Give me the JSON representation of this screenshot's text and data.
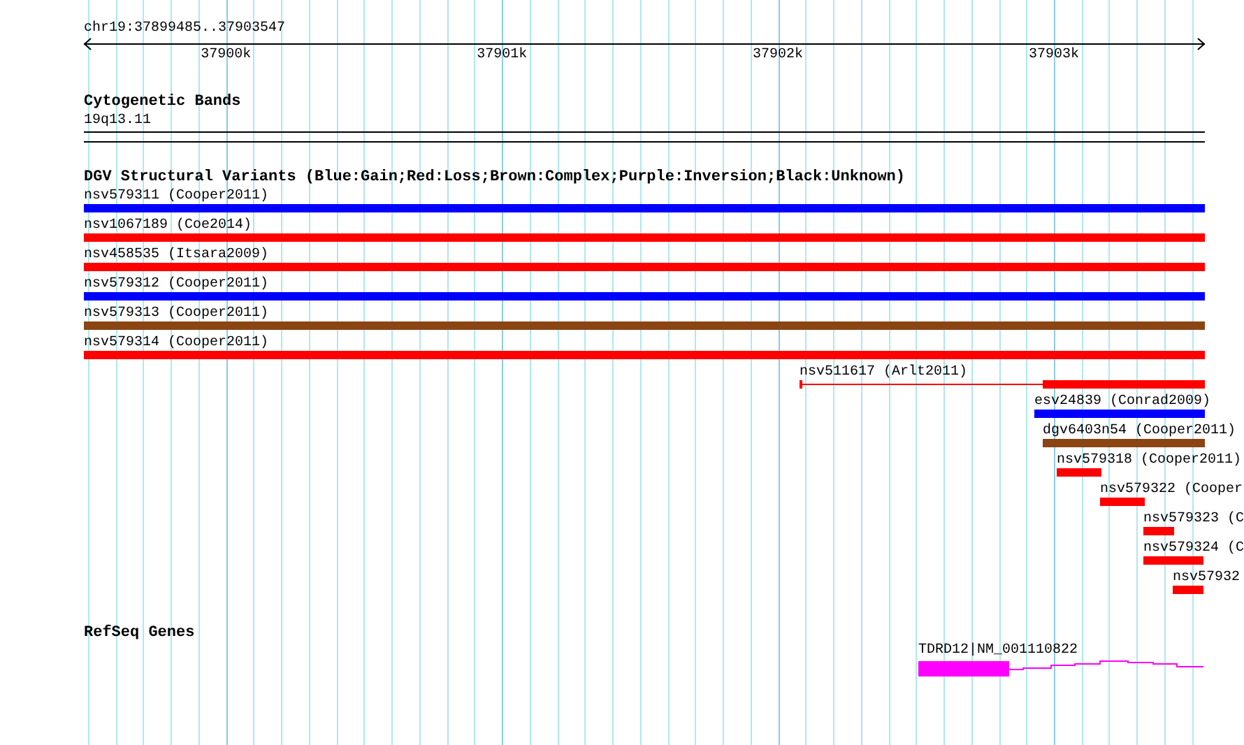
{
  "ruler": {
    "position": "chr19:37899485..37903547",
    "ticks": [
      "37900k",
      "37901k",
      "37902k",
      "37903k"
    ]
  },
  "cytogenetic_bands": {
    "title": "Cytogenetic Bands",
    "bands": [
      {
        "name": "19q13.11"
      }
    ]
  },
  "dgv": {
    "title": "DGV Structural Variants (Blue:Gain;Red:Loss;Brown:Complex;Purple:Inversion;Black:Unknown)",
    "features": [
      {
        "label": "nsv579311 (Cooper2011)",
        "color": "#0000ff",
        "kind": "block"
      },
      {
        "label": "nsv1067189 (Coe2014)",
        "color": "#ff0000",
        "kind": "block"
      },
      {
        "label": "nsv458535 (Itsara2009)",
        "color": "#ff0000",
        "kind": "block"
      },
      {
        "label": "nsv579312 (Cooper2011)",
        "color": "#0000ff",
        "kind": "block"
      },
      {
        "label": "nsv579313 (Cooper2011)",
        "color": "#8b4513",
        "kind": "block"
      },
      {
        "label": "nsv579314 (Cooper2011)",
        "color": "#ff0000",
        "kind": "block"
      },
      {
        "label": "nsv511617 (Arlt2011)",
        "color": "#ff0000",
        "kind": "split"
      },
      {
        "label": "esv24839 (Conrad2009)",
        "color": "#0000ff",
        "kind": "block"
      },
      {
        "label": "dgv6403n54 (Cooper2011)",
        "color": "#8b4513",
        "kind": "block"
      },
      {
        "label": "nsv579318 (Cooper2011)",
        "color": "#ff0000",
        "kind": "block"
      },
      {
        "label": "nsv579322 (Cooper",
        "color": "#ff0000",
        "kind": "block"
      },
      {
        "label": "nsv579323 (C",
        "color": "#ff0000",
        "kind": "block"
      },
      {
        "label": "nsv579324 (C",
        "color": "#ff0000",
        "kind": "block"
      },
      {
        "label": "nsv57932",
        "color": "#ff0000",
        "kind": "block"
      }
    ]
  },
  "refseq": {
    "title": "RefSeq Genes",
    "genes": [
      {
        "label": "TDRD12|NM_001110822"
      }
    ]
  }
}
